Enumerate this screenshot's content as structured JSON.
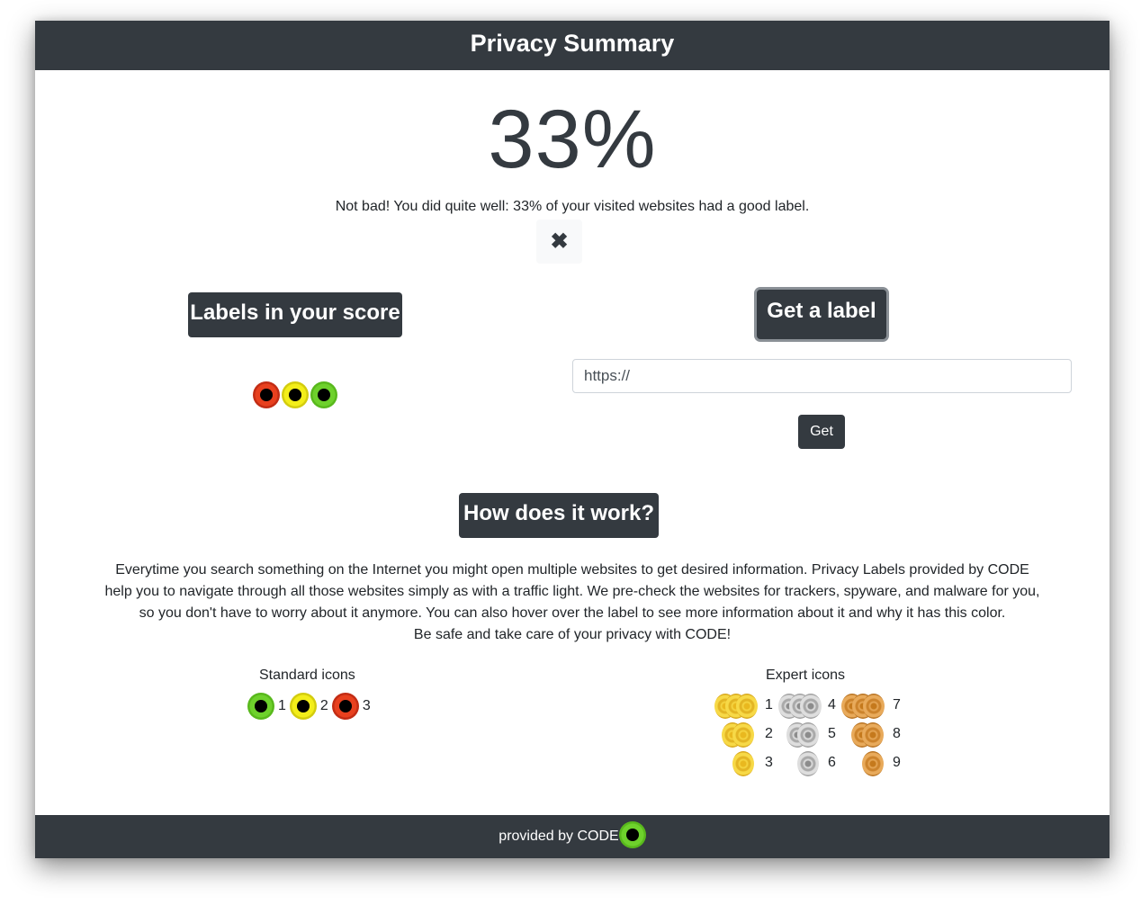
{
  "header": {
    "title": "Privacy Summary"
  },
  "score": {
    "value": "33%",
    "message": "Not bad! You did quite well: 33% of your visited websites had a good label.",
    "close_icon": "close-icon"
  },
  "labels_section": {
    "title": "Labels in your score",
    "dots": [
      "red",
      "yellow",
      "green"
    ]
  },
  "get_label_section": {
    "title": "Get a label",
    "input_value": "https://",
    "button_label": "Get"
  },
  "how_section": {
    "title": "How does it work?",
    "description_lines": [
      "Everytime you search something on the Internet you might open multiple websites to get desired information. Privacy Labels provided by CODE",
      "help you to navigate through all those websites simply as with a traffic light. We pre-check the websites for trackers, spyware, and malware for you,",
      "so you don't have to worry about it anymore. You can also hover over the label to see more information about it and why it has this color.",
      "Be safe and take care of your privacy with CODE!"
    ]
  },
  "standard_icons": {
    "title": "Standard icons",
    "items": [
      {
        "color": "green",
        "num": "1"
      },
      {
        "color": "yellow",
        "num": "2"
      },
      {
        "color": "red",
        "num": "3"
      }
    ]
  },
  "expert_icons": {
    "title": "Expert icons",
    "nums": [
      "1",
      "2",
      "3",
      "4",
      "5",
      "6",
      "7",
      "8",
      "9"
    ],
    "colors": {
      "gold": "#f4d23e",
      "silver": "#d9d9d9",
      "bronze": "#e3a352"
    }
  },
  "footer": {
    "text": "provided by CODE"
  },
  "colors": {
    "dark": "#343a40",
    "red": "#e8401e",
    "yellow": "#f3ee1a",
    "green": "#6ed12c"
  }
}
